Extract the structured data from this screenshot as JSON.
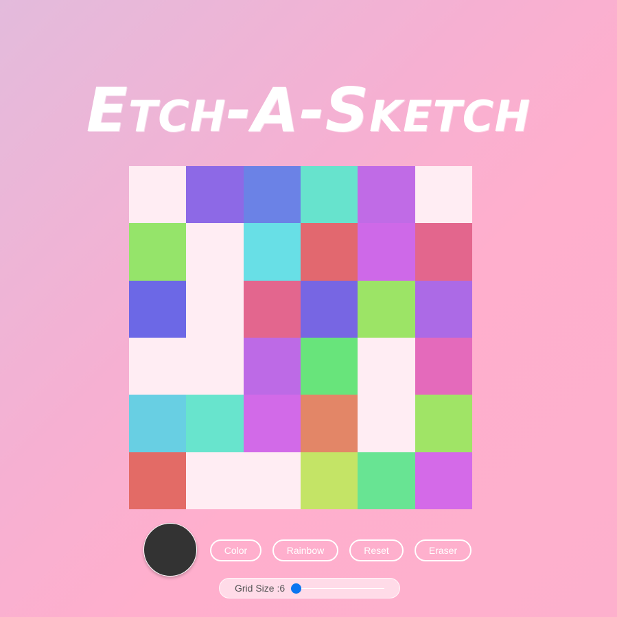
{
  "header": {
    "title": "Etch-A-Sketch"
  },
  "grid": {
    "size": 6,
    "cells": [
      "#ffedf3",
      "#8d69e6",
      "#6b82e6",
      "#67e3cd",
      "#c06be6",
      "#ffedf3",
      "#95e46a",
      "#ffedf3",
      "#68dfe6",
      "#e2686f",
      "#ce69e8",
      "#e3668d",
      "#6c68e6",
      "#ffedf3",
      "#e3668e",
      "#7766e3",
      "#9ce466",
      "#ac6ae6",
      "#ffedf3",
      "#ffedf3",
      "#bd6ae6",
      "#68e47b",
      "#ffedf3",
      "#e46abb",
      "#68cfe3",
      "#68e4cd",
      "#d26ae8",
      "#e38667",
      "#ffedf3",
      "#a0e466",
      "#e36b66",
      "#ffedf3",
      "#ffedf3",
      "#c4e466",
      "#68e493",
      "#d46ae8"
    ]
  },
  "controls": {
    "current_color": "#333333",
    "color_label": "Color",
    "rainbow_label": "Rainbow",
    "reset_label": "Reset",
    "eraser_label": "Eraser"
  },
  "slider": {
    "label": "Grid Size :6",
    "value": 6
  }
}
